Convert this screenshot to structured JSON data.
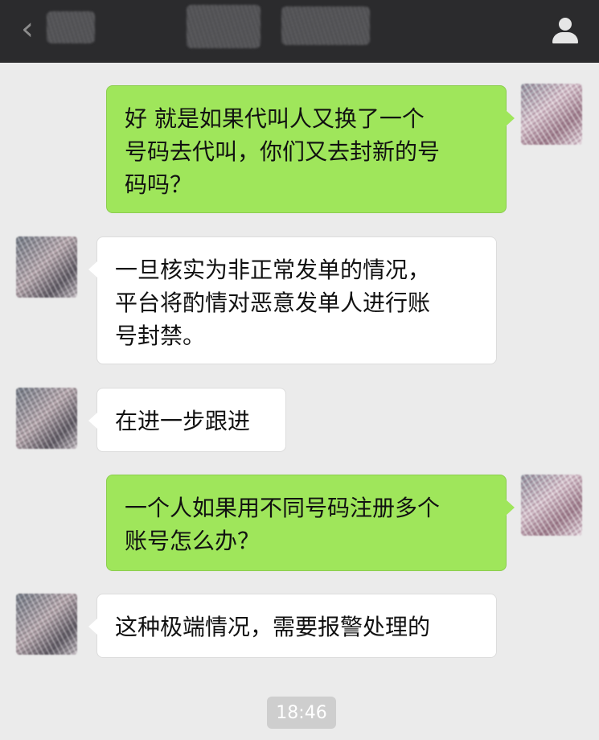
{
  "navbar": {
    "back_icon": "chevron-left-icon",
    "profile_icon": "person-icon",
    "title_obscured": true
  },
  "messages": [
    {
      "side": "sent",
      "text": "好  就是如果代叫人又换了一个\n号码去代叫，你们又去封新的号\n码吗？"
    },
    {
      "side": "received",
      "text": "一旦核实为非正常发单的情况，\n平台将酌情对恶意发单人进行账\n号封禁。"
    },
    {
      "side": "received",
      "text": "在进一步跟进"
    },
    {
      "side": "sent",
      "text": "一个人如果用不同号码注册多个\n账号怎么办？"
    },
    {
      "side": "received",
      "text": "这种极端情况，需要报警处理的"
    }
  ],
  "timestamp": "18:46",
  "colors": {
    "sent_bubble": "#9fe65b",
    "received_bubble": "#ffffff",
    "background": "#ebebeb",
    "navbar": "#2b2b2d"
  }
}
